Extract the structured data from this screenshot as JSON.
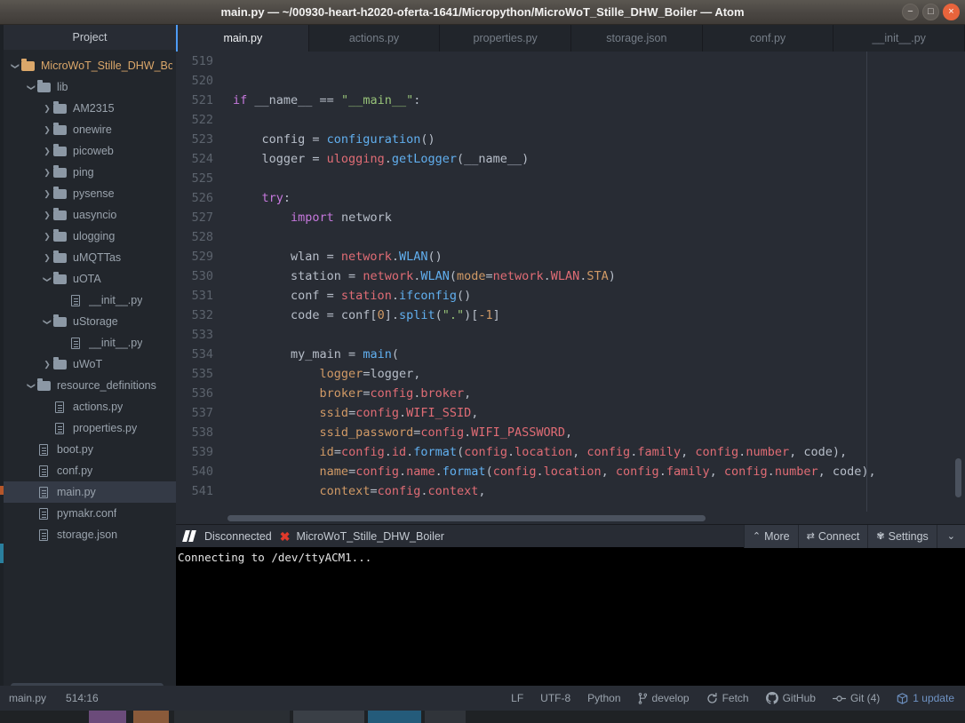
{
  "window": {
    "title": "main.py — ~/00930-heart-h2020-oferta-1641/Micropython/MicroWoT_Stille_DHW_Boiler — Atom",
    "minimize": "−",
    "maximize": "□",
    "close": "×"
  },
  "sidebar": {
    "header": "Project",
    "tree": [
      {
        "label": "MicroWoT_Stille_DHW_Boile",
        "type": "folder-open",
        "indent": 0,
        "root": true
      },
      {
        "label": "lib",
        "type": "folder-open",
        "indent": 1
      },
      {
        "label": "AM2315",
        "type": "folder",
        "indent": 2
      },
      {
        "label": "onewire",
        "type": "folder",
        "indent": 2
      },
      {
        "label": "picoweb",
        "type": "folder",
        "indent": 2
      },
      {
        "label": "ping",
        "type": "folder",
        "indent": 2
      },
      {
        "label": "pysense",
        "type": "folder",
        "indent": 2
      },
      {
        "label": "uasyncio",
        "type": "folder",
        "indent": 2
      },
      {
        "label": "ulogging",
        "type": "folder",
        "indent": 2
      },
      {
        "label": "uMQTTas",
        "type": "folder",
        "indent": 2
      },
      {
        "label": "uOTA",
        "type": "folder-open",
        "indent": 2
      },
      {
        "label": "__init__.py",
        "type": "file",
        "indent": 3
      },
      {
        "label": "uStorage",
        "type": "folder-open",
        "indent": 2
      },
      {
        "label": "__init__.py",
        "type": "file",
        "indent": 3
      },
      {
        "label": "uWoT",
        "type": "folder",
        "indent": 2
      },
      {
        "label": "resource_definitions",
        "type": "folder-open",
        "indent": 1
      },
      {
        "label": "actions.py",
        "type": "file",
        "indent": 2
      },
      {
        "label": "properties.py",
        "type": "file",
        "indent": 2
      },
      {
        "label": "boot.py",
        "type": "file",
        "indent": 1
      },
      {
        "label": "conf.py",
        "type": "file",
        "indent": 1
      },
      {
        "label": "main.py",
        "type": "file",
        "indent": 1,
        "selected": true
      },
      {
        "label": "pymakr.conf",
        "type": "file",
        "indent": 1
      },
      {
        "label": "storage.json",
        "type": "file",
        "indent": 1
      }
    ]
  },
  "tabs": [
    {
      "label": "main.py",
      "active": true
    },
    {
      "label": "actions.py",
      "active": false
    },
    {
      "label": "properties.py",
      "active": false
    },
    {
      "label": "storage.json",
      "active": false
    },
    {
      "label": "conf.py",
      "active": false
    },
    {
      "label": "__init__.py",
      "active": false
    }
  ],
  "editor": {
    "lines": [
      {
        "n": "519",
        "tokens": []
      },
      {
        "n": "520",
        "tokens": []
      },
      {
        "n": "521",
        "tokens": [
          {
            "t": "if",
            "c": "kw"
          },
          {
            "t": " __name__ ",
            "c": "pl"
          },
          {
            "t": "==",
            "c": "pl"
          },
          {
            "t": " ",
            "c": "pl"
          },
          {
            "t": "\"__main__\"",
            "c": "str"
          },
          {
            "t": ":",
            "c": "pl"
          }
        ]
      },
      {
        "n": "522",
        "tokens": []
      },
      {
        "n": "523",
        "tokens": [
          {
            "t": "    config = ",
            "c": "pl"
          },
          {
            "t": "configuration",
            "c": "fn"
          },
          {
            "t": "()",
            "c": "pl"
          }
        ]
      },
      {
        "n": "524",
        "tokens": [
          {
            "t": "    logger = ",
            "c": "pl"
          },
          {
            "t": "ulogging",
            "c": "var"
          },
          {
            "t": ".",
            "c": "pl"
          },
          {
            "t": "getLogger",
            "c": "fn"
          },
          {
            "t": "(__name__)",
            "c": "pl"
          }
        ]
      },
      {
        "n": "525",
        "tokens": []
      },
      {
        "n": "526",
        "tokens": [
          {
            "t": "    ",
            "c": "pl"
          },
          {
            "t": "try",
            "c": "kw"
          },
          {
            "t": ":",
            "c": "pl"
          }
        ]
      },
      {
        "n": "527",
        "tokens": [
          {
            "t": "        ",
            "c": "pl"
          },
          {
            "t": "import",
            "c": "kw"
          },
          {
            "t": " network",
            "c": "pl"
          }
        ]
      },
      {
        "n": "528",
        "tokens": []
      },
      {
        "n": "529",
        "tokens": [
          {
            "t": "        wlan = ",
            "c": "pl"
          },
          {
            "t": "network",
            "c": "var"
          },
          {
            "t": ".",
            "c": "pl"
          },
          {
            "t": "WLAN",
            "c": "fn"
          },
          {
            "t": "()",
            "c": "pl"
          }
        ]
      },
      {
        "n": "530",
        "tokens": [
          {
            "t": "        station = ",
            "c": "pl"
          },
          {
            "t": "network",
            "c": "var"
          },
          {
            "t": ".",
            "c": "pl"
          },
          {
            "t": "WLAN",
            "c": "fn"
          },
          {
            "t": "(",
            "c": "pl"
          },
          {
            "t": "mode",
            "c": "num"
          },
          {
            "t": "=",
            "c": "pl"
          },
          {
            "t": "network",
            "c": "var"
          },
          {
            "t": ".",
            "c": "pl"
          },
          {
            "t": "WLAN",
            "c": "var"
          },
          {
            "t": ".",
            "c": "pl"
          },
          {
            "t": "STA",
            "c": "num"
          },
          {
            "t": ")",
            "c": "pl"
          }
        ]
      },
      {
        "n": "531",
        "tokens": [
          {
            "t": "        conf = ",
            "c": "pl"
          },
          {
            "t": "station",
            "c": "var"
          },
          {
            "t": ".",
            "c": "pl"
          },
          {
            "t": "ifconfig",
            "c": "fn"
          },
          {
            "t": "()",
            "c": "pl"
          }
        ]
      },
      {
        "n": "532",
        "tokens": [
          {
            "t": "        code = conf[",
            "c": "pl"
          },
          {
            "t": "0",
            "c": "num"
          },
          {
            "t": "].",
            "c": "pl"
          },
          {
            "t": "split",
            "c": "fn"
          },
          {
            "t": "(",
            "c": "pl"
          },
          {
            "t": "\".\"",
            "c": "str"
          },
          {
            "t": ")[",
            "c": "pl"
          },
          {
            "t": "-1",
            "c": "num"
          },
          {
            "t": "]",
            "c": "pl"
          }
        ]
      },
      {
        "n": "533",
        "tokens": []
      },
      {
        "n": "534",
        "tokens": [
          {
            "t": "        my_main = ",
            "c": "pl"
          },
          {
            "t": "main",
            "c": "fn"
          },
          {
            "t": "(",
            "c": "pl"
          }
        ]
      },
      {
        "n": "535",
        "tokens": [
          {
            "t": "            ",
            "c": "pl"
          },
          {
            "t": "logger",
            "c": "num"
          },
          {
            "t": "=logger,",
            "c": "pl"
          }
        ]
      },
      {
        "n": "536",
        "tokens": [
          {
            "t": "            ",
            "c": "pl"
          },
          {
            "t": "broker",
            "c": "num"
          },
          {
            "t": "=",
            "c": "pl"
          },
          {
            "t": "config",
            "c": "var"
          },
          {
            "t": ".",
            "c": "pl"
          },
          {
            "t": "broker",
            "c": "var"
          },
          {
            "t": ",",
            "c": "pl"
          }
        ]
      },
      {
        "n": "537",
        "tokens": [
          {
            "t": "            ",
            "c": "pl"
          },
          {
            "t": "ssid",
            "c": "num"
          },
          {
            "t": "=",
            "c": "pl"
          },
          {
            "t": "config",
            "c": "var"
          },
          {
            "t": ".",
            "c": "pl"
          },
          {
            "t": "WIFI_SSID",
            "c": "var"
          },
          {
            "t": ",",
            "c": "pl"
          }
        ]
      },
      {
        "n": "538",
        "tokens": [
          {
            "t": "            ",
            "c": "pl"
          },
          {
            "t": "ssid_password",
            "c": "num"
          },
          {
            "t": "=",
            "c": "pl"
          },
          {
            "t": "config",
            "c": "var"
          },
          {
            "t": ".",
            "c": "pl"
          },
          {
            "t": "WIFI_PASSWORD",
            "c": "var"
          },
          {
            "t": ",",
            "c": "pl"
          }
        ]
      },
      {
        "n": "539",
        "tokens": [
          {
            "t": "            ",
            "c": "pl"
          },
          {
            "t": "id",
            "c": "num"
          },
          {
            "t": "=",
            "c": "pl"
          },
          {
            "t": "config",
            "c": "var"
          },
          {
            "t": ".",
            "c": "pl"
          },
          {
            "t": "id",
            "c": "var"
          },
          {
            "t": ".",
            "c": "pl"
          },
          {
            "t": "format",
            "c": "fn"
          },
          {
            "t": "(",
            "c": "pl"
          },
          {
            "t": "config",
            "c": "var"
          },
          {
            "t": ".",
            "c": "pl"
          },
          {
            "t": "location",
            "c": "var"
          },
          {
            "t": ", ",
            "c": "pl"
          },
          {
            "t": "config",
            "c": "var"
          },
          {
            "t": ".",
            "c": "pl"
          },
          {
            "t": "family",
            "c": "var"
          },
          {
            "t": ", ",
            "c": "pl"
          },
          {
            "t": "config",
            "c": "var"
          },
          {
            "t": ".",
            "c": "pl"
          },
          {
            "t": "number",
            "c": "var"
          },
          {
            "t": ", code),",
            "c": "pl"
          }
        ]
      },
      {
        "n": "540",
        "tokens": [
          {
            "t": "            ",
            "c": "pl"
          },
          {
            "t": "name",
            "c": "num"
          },
          {
            "t": "=",
            "c": "pl"
          },
          {
            "t": "config",
            "c": "var"
          },
          {
            "t": ".",
            "c": "pl"
          },
          {
            "t": "name",
            "c": "var"
          },
          {
            "t": ".",
            "c": "pl"
          },
          {
            "t": "format",
            "c": "fn"
          },
          {
            "t": "(",
            "c": "pl"
          },
          {
            "t": "config",
            "c": "var"
          },
          {
            "t": ".",
            "c": "pl"
          },
          {
            "t": "location",
            "c": "var"
          },
          {
            "t": ", ",
            "c": "pl"
          },
          {
            "t": "config",
            "c": "var"
          },
          {
            "t": ".",
            "c": "pl"
          },
          {
            "t": "family",
            "c": "var"
          },
          {
            "t": ", ",
            "c": "pl"
          },
          {
            "t": "config",
            "c": "var"
          },
          {
            "t": ".",
            "c": "pl"
          },
          {
            "t": "number",
            "c": "var"
          },
          {
            "t": ", code),",
            "c": "pl"
          }
        ]
      },
      {
        "n": "541",
        "tokens": [
          {
            "t": "            ",
            "c": "pl"
          },
          {
            "t": "context",
            "c": "num"
          },
          {
            "t": "=",
            "c": "pl"
          },
          {
            "t": "config",
            "c": "var"
          },
          {
            "t": ".",
            "c": "pl"
          },
          {
            "t": "context",
            "c": "var"
          },
          {
            "t": ",",
            "c": "pl"
          }
        ]
      }
    ]
  },
  "pymakr": {
    "status": "Disconnected",
    "disconnect_mark": "✖",
    "project": "MicroWoT_Stille_DHW_Boiler",
    "more_label": "More",
    "more_icon": "⌃",
    "connect_label": "Connect",
    "connect_icon": "⇄",
    "settings_label": "Settings",
    "settings_icon": "✾",
    "caret_icon": "⌄",
    "terminal_text": "Connecting to /dev/ttyACM1..."
  },
  "statusbar": {
    "file": "main.py",
    "cursor": "514:16",
    "line_ending": "LF",
    "encoding": "UTF-8",
    "grammar": "Python",
    "branch": "develop",
    "fetch": "Fetch",
    "github": "GitHub",
    "git": "Git (4)",
    "update": "1 update"
  },
  "colors": {
    "accent_blue": "#4d9bf5",
    "update_blue": "#6f93c4",
    "close_orange": "#e8643c",
    "folder_orange": "#dba76a",
    "error_red": "#e0392b"
  }
}
